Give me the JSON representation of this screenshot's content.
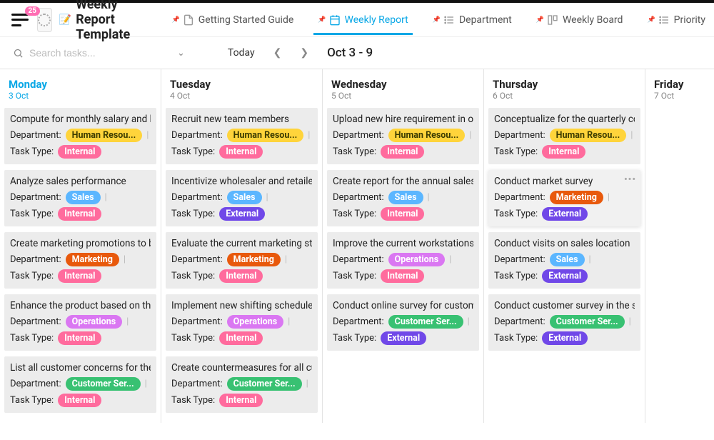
{
  "header": {
    "badge_count": "25",
    "page_title": "Weekly Report Template",
    "tabs": [
      {
        "label": "Getting Started Guide"
      },
      {
        "label": "Weekly Report"
      },
      {
        "label": "Department"
      },
      {
        "label": "Weekly Board"
      },
      {
        "label": "Priority"
      }
    ]
  },
  "controls": {
    "search_placeholder": "Search tasks...",
    "today_label": "Today",
    "date_range": "Oct 3 - 9"
  },
  "labels": {
    "department": "Department:",
    "task_type": "Task Type:"
  },
  "departments": {
    "hr": "Human Resou...",
    "sales": "Sales",
    "marketing": "Marketing",
    "operations": "Operations",
    "cs": "Customer Ser..."
  },
  "task_types": {
    "internal": "Internal",
    "external": "External"
  },
  "days": [
    {
      "name": "Monday",
      "date": "3 Oct",
      "active": true,
      "cards": [
        {
          "title": "Compute for monthly salary and benefits",
          "dep": "hr",
          "tt": "internal"
        },
        {
          "title": "Analyze sales performance",
          "dep": "sales",
          "tt": "internal"
        },
        {
          "title": "Create marketing promotions to boost",
          "dep": "marketing",
          "tt": "internal"
        },
        {
          "title": "Enhance the product based on the l",
          "dep": "operations",
          "tt": "internal"
        },
        {
          "title": "List all customer concerns for the m",
          "dep": "cs",
          "tt": "internal"
        }
      ]
    },
    {
      "name": "Tuesday",
      "date": "4 Oct",
      "cards": [
        {
          "title": "Recruit new team members",
          "dep": "hr",
          "tt": "internal"
        },
        {
          "title": "Incentivize wholesaler and retailers t",
          "dep": "sales",
          "tt": "external"
        },
        {
          "title": "Evaluate the current marketing statu",
          "dep": "marketing",
          "tt": "internal"
        },
        {
          "title": "Implement new shifting schedule to",
          "dep": "operations",
          "tt": "internal"
        },
        {
          "title": "Create countermeasures for all custo",
          "dep": "cs",
          "tt": "internal"
        }
      ]
    },
    {
      "name": "Wednesday",
      "date": "5 Oct",
      "cards": [
        {
          "title": "Upload new hire requirement in offic",
          "dep": "hr",
          "tt": "internal"
        },
        {
          "title": "Create report for the annual sales",
          "dep": "sales",
          "tt": "internal"
        },
        {
          "title": "Improve the current workstations fo",
          "dep": "operations",
          "tt": "internal"
        },
        {
          "title": "Conduct online survey for customer",
          "dep": "cs",
          "tt": "external"
        }
      ]
    },
    {
      "name": "Thursday",
      "date": "6 Oct",
      "cards": [
        {
          "title": "Conceptualize for the quarterly com",
          "dep": "hr",
          "tt": "internal"
        },
        {
          "title": "Conduct market survey",
          "dep": "marketing",
          "tt": "external",
          "highlight": true,
          "menu": true
        },
        {
          "title": "Conduct visits on sales location",
          "dep": "sales",
          "tt": "external"
        },
        {
          "title": "Conduct customer survey in the sale",
          "dep": "cs",
          "tt": "external"
        }
      ]
    },
    {
      "name": "Friday",
      "date": "7 Oct",
      "cards": []
    }
  ]
}
